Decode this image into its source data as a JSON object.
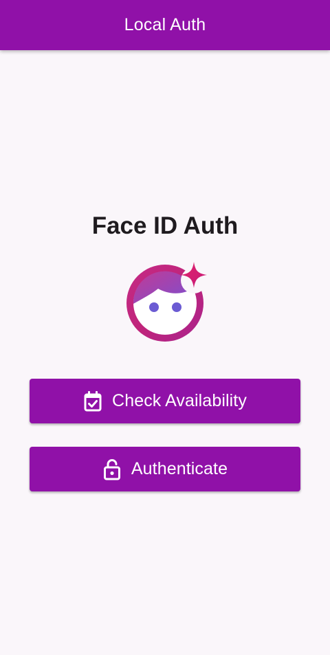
{
  "app_bar": {
    "title": "Local Auth",
    "background": "#9011a8"
  },
  "main": {
    "title": "Face ID Auth",
    "hero_icon": "face-id-icon",
    "buttons": [
      {
        "label": "Check Availability",
        "icon": "calendar-check-icon"
      },
      {
        "label": "Authenticate",
        "icon": "unlock-icon"
      }
    ]
  },
  "colors": {
    "primary": "#9011a8",
    "background": "#faf6fa",
    "text": "#1f1b1f",
    "icon_gradient_start": "#e0226a",
    "icon_gradient_end": "#8e32c8",
    "face_eyes": "#6b5bd3"
  }
}
